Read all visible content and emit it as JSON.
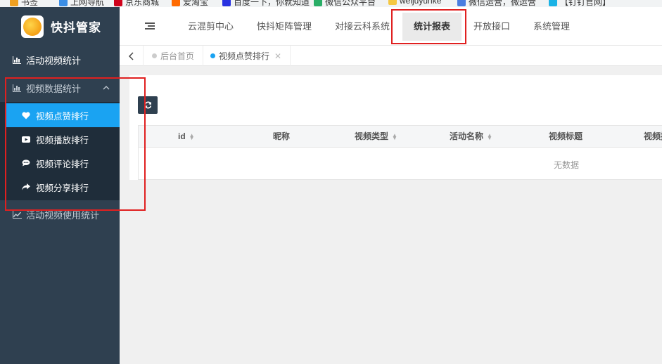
{
  "bookmarks": [
    {
      "label": "书签",
      "color": "#f0a020"
    },
    {
      "label": "上网导航",
      "color": "#3a8ee6"
    },
    {
      "label": "京东商城",
      "color": "#d0021b"
    },
    {
      "label": "爱淘宝",
      "color": "#ff6a00"
    },
    {
      "label": "百度一下，你就知道",
      "color": "#2932e1"
    },
    {
      "label": "微信公众平台",
      "color": "#2aae67"
    },
    {
      "label": "weijuyunke",
      "color": "#f5c842"
    },
    {
      "label": "微信运营，微运营",
      "color": "#4a7de0"
    },
    {
      "label": "【钉钉官网】 ",
      "color": "#1ab3e6"
    }
  ],
  "brand": {
    "name": "快抖管家"
  },
  "sidebar": {
    "items": [
      {
        "label": "活动视频统计",
        "icon": "bar-chart-icon"
      },
      {
        "label": "视频数据统计",
        "icon": "bar-chart-icon",
        "expanded": true,
        "children": [
          {
            "label": "视频点赞排行",
            "icon": "heart-icon",
            "active": true
          },
          {
            "label": "视频播放排行",
            "icon": "play-icon"
          },
          {
            "label": "视频评论排行",
            "icon": "comment-icon"
          },
          {
            "label": "视频分享排行",
            "icon": "share-icon"
          }
        ]
      },
      {
        "label": "活动视频使用统计",
        "icon": "line-chart-icon"
      }
    ]
  },
  "topnav": {
    "tabs": [
      {
        "label": "云混剪中心"
      },
      {
        "label": "快抖矩阵管理"
      },
      {
        "label": "对接云科系统"
      },
      {
        "label": "统计报表",
        "active": true
      },
      {
        "label": "开放接口"
      },
      {
        "label": "系统管理"
      }
    ]
  },
  "pagetabs": [
    {
      "label": "后台首页"
    },
    {
      "label": "视频点赞排行",
      "active": true,
      "closable": true
    }
  ],
  "table": {
    "columns": [
      {
        "label": "id",
        "sortable": true
      },
      {
        "label": "昵称",
        "sortable": false
      },
      {
        "label": "视频类型",
        "sortable": true
      },
      {
        "label": "活动名称",
        "sortable": true
      },
      {
        "label": "视频标题",
        "sortable": false
      },
      {
        "label": "视频播",
        "sortable": false
      }
    ],
    "empty_text": "无数据"
  },
  "colors": {
    "sidebar_bg": "#2f4050",
    "submenu_bg": "#1f2d3a",
    "active_item": "#1aa3f2",
    "highlight_border": "#e02020"
  }
}
